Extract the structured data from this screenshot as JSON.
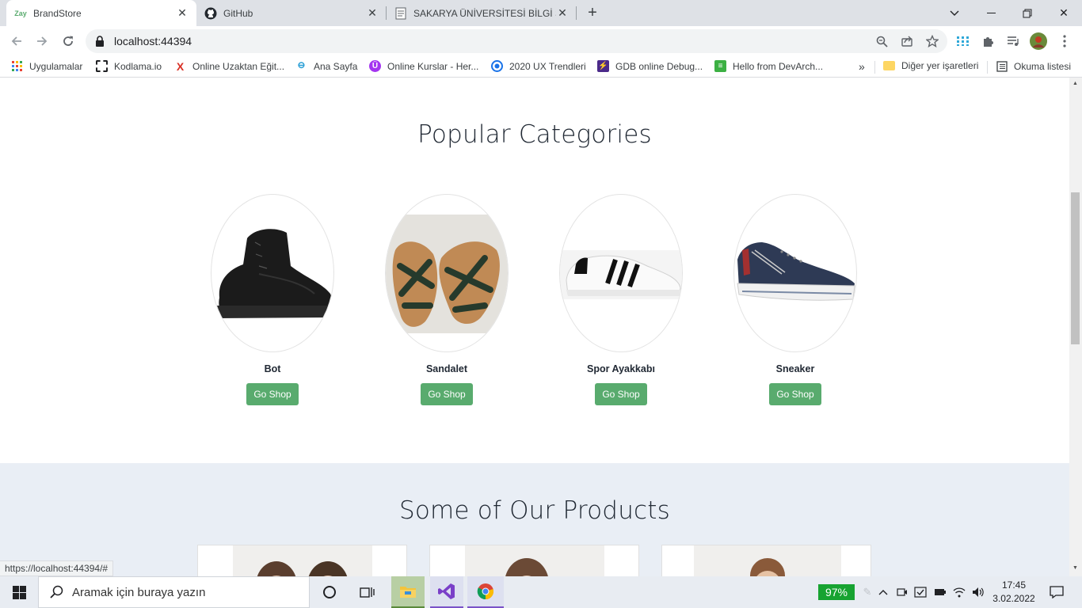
{
  "tabs": [
    {
      "title": "BrandStore",
      "favicon": "Zay",
      "active": true
    },
    {
      "title": "GitHub",
      "favicon": "github-icon",
      "active": false
    },
    {
      "title": "SAKARYA ÜNİVERSİTESİ BİLGİ SİS",
      "favicon": "doc-icon",
      "active": false
    }
  ],
  "address": {
    "url": "localhost:44394"
  },
  "bookmarks": [
    {
      "label": "Uygulamalar",
      "icon": "apps-grid-icon"
    },
    {
      "label": "Kodlama.io",
      "icon": "kodlama-icon"
    },
    {
      "label": "Online Uzaktan Eğit...",
      "icon": "x-logo-icon"
    },
    {
      "label": "Ana Sayfa",
      "icon": "leaf-icon"
    },
    {
      "label": "Online Kurslar - Her...",
      "icon": "udemy-icon"
    },
    {
      "label": "2020 UX Trendleri",
      "icon": "circle-icon"
    },
    {
      "label": "GDB online Debug...",
      "icon": "gdb-icon"
    },
    {
      "label": "Hello from DevArch...",
      "icon": "devarch-icon"
    }
  ],
  "bookmarks_more": "»",
  "bookmarks_other": "Diğer yer işaretleri",
  "reading_list": "Okuma listesi",
  "page": {
    "categories_title": "Popular Categories",
    "categories": [
      {
        "name": "Bot",
        "button": "Go Shop"
      },
      {
        "name": "Sandalet",
        "button": "Go Shop"
      },
      {
        "name": "Spor Ayakkabı",
        "button": "Go Shop"
      },
      {
        "name": "Sneaker",
        "button": "Go Shop"
      }
    ],
    "products_title": "Some of Our Products"
  },
  "status_url": "https://localhost:44394/#",
  "taskbar": {
    "search_placeholder": "Aramak için buraya yazın",
    "battery": "97%",
    "time": "17:45",
    "date": "3.02.2022"
  },
  "colors": {
    "accent_green": "#59ab6e",
    "products_bg": "#e9eef5",
    "battery_green": "#17a331"
  }
}
